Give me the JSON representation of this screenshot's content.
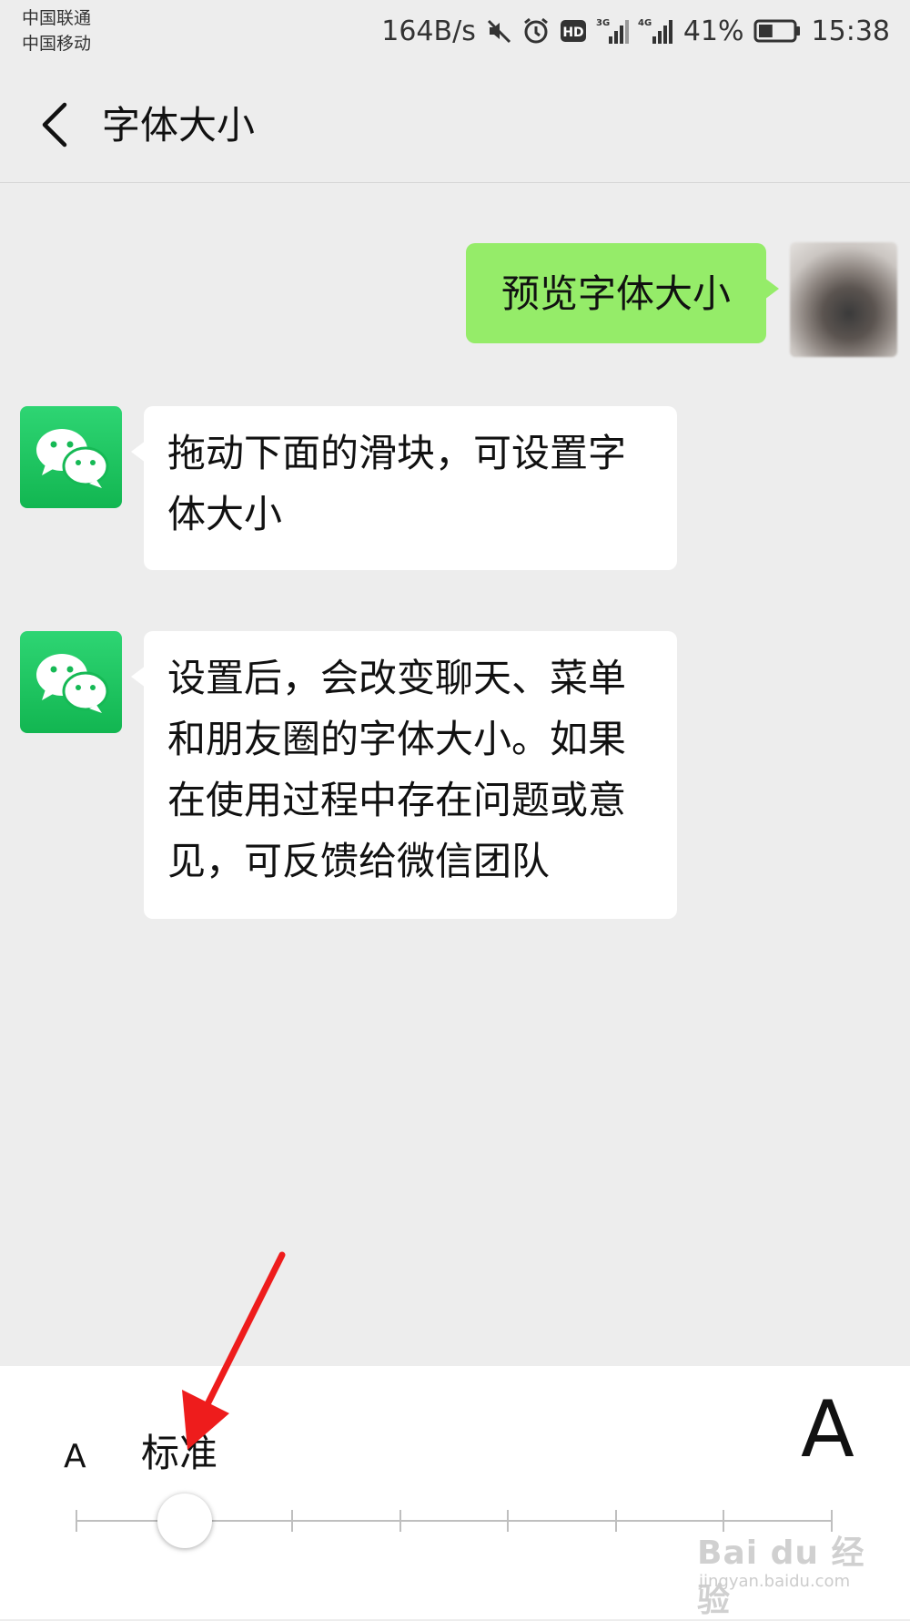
{
  "status_bar": {
    "carrier_1": "中国联通",
    "carrier_2": "中国移动",
    "net_speed": "164B/s",
    "signal_1_label": "3G",
    "signal_2_label": "4G",
    "hd_label": "HD",
    "battery_percent": "41%",
    "battery_level": 0.41,
    "time": "15:38",
    "icons": [
      "mute-icon",
      "alarm-icon",
      "hd-icon",
      "signal-3g-icon",
      "signal-4g-icon",
      "battery-icon"
    ]
  },
  "nav": {
    "title": "字体大小",
    "back_icon": "chevron-left-icon"
  },
  "messages": [
    {
      "from": "me",
      "text": "预览字体大小"
    },
    {
      "from": "wechat",
      "text": "拖动下面的滑块，可设置字体大小"
    },
    {
      "from": "wechat",
      "text": "设置后，会改变聊天、菜单和朋友圈的字体大小。如果在使用过程中存在问题或意见，可反馈给微信团队"
    }
  ],
  "font_size_control": {
    "small_label": "A",
    "large_label": "A",
    "current_level_label": "标准",
    "steps": 8,
    "selected_step": 2
  },
  "colors": {
    "background": "#ededed",
    "my_bubble": "#95ec69",
    "other_bubble": "#ffffff",
    "wechat_green": "#07c160",
    "annotation_arrow": "#ee1c1c"
  },
  "watermark": {
    "brand": "Bai du 经验",
    "site": "jingyan.baidu.com"
  }
}
